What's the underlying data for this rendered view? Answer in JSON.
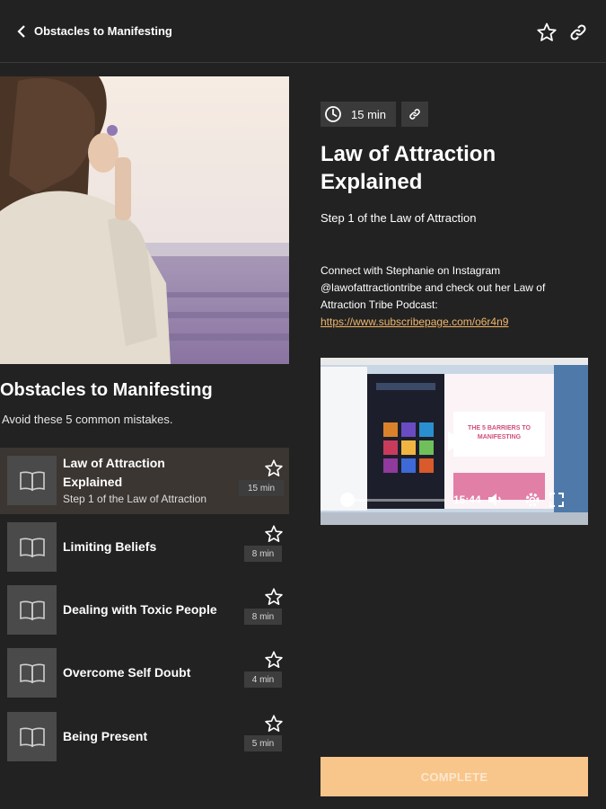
{
  "header": {
    "title": "Obstacles to Manifesting",
    "back_icon": "chevron-left-icon",
    "favorite_icon": "star-outline-icon",
    "share_icon": "link-icon"
  },
  "course": {
    "title": "Obstacles to Manifesting",
    "subtitle": "Avoid these 5 common mistakes."
  },
  "lessons": [
    {
      "title_line1": "Law of Attraction",
      "title_line2": "Explained",
      "step": "Step 1 of the Law of Attraction",
      "duration": "15 min",
      "active": true
    },
    {
      "title": "Limiting Beliefs",
      "duration": "8 min"
    },
    {
      "title": "Dealing with Toxic People",
      "duration": "8 min"
    },
    {
      "title": "Overcome Self Doubt",
      "duration": "4 min"
    },
    {
      "title": "Being Present",
      "duration": "5 min"
    }
  ],
  "detail": {
    "duration": "15 min",
    "title_line1": "Law of Attraction",
    "title_line2": "Explained",
    "step": "Step 1 of the Law of Attraction",
    "desc_line1": "Connect with Stephanie on Instagram",
    "desc_line2": "@lawofattractiontribe and check out her Law of",
    "desc_line3": "Attraction Tribe Podcast:",
    "link": "https://www.subscribepage.com/o6r4n9"
  },
  "video": {
    "time": "15:44",
    "progress": 0.0,
    "slide_line1": "THE 5 BARRIERS TO",
    "slide_line2": "MANIFESTING"
  },
  "actions": {
    "complete": "COMPLETE"
  },
  "colors": {
    "background": "#222222",
    "accent": "#f8c68a",
    "link": "#f1b66a",
    "active_row": "#3b3632"
  }
}
